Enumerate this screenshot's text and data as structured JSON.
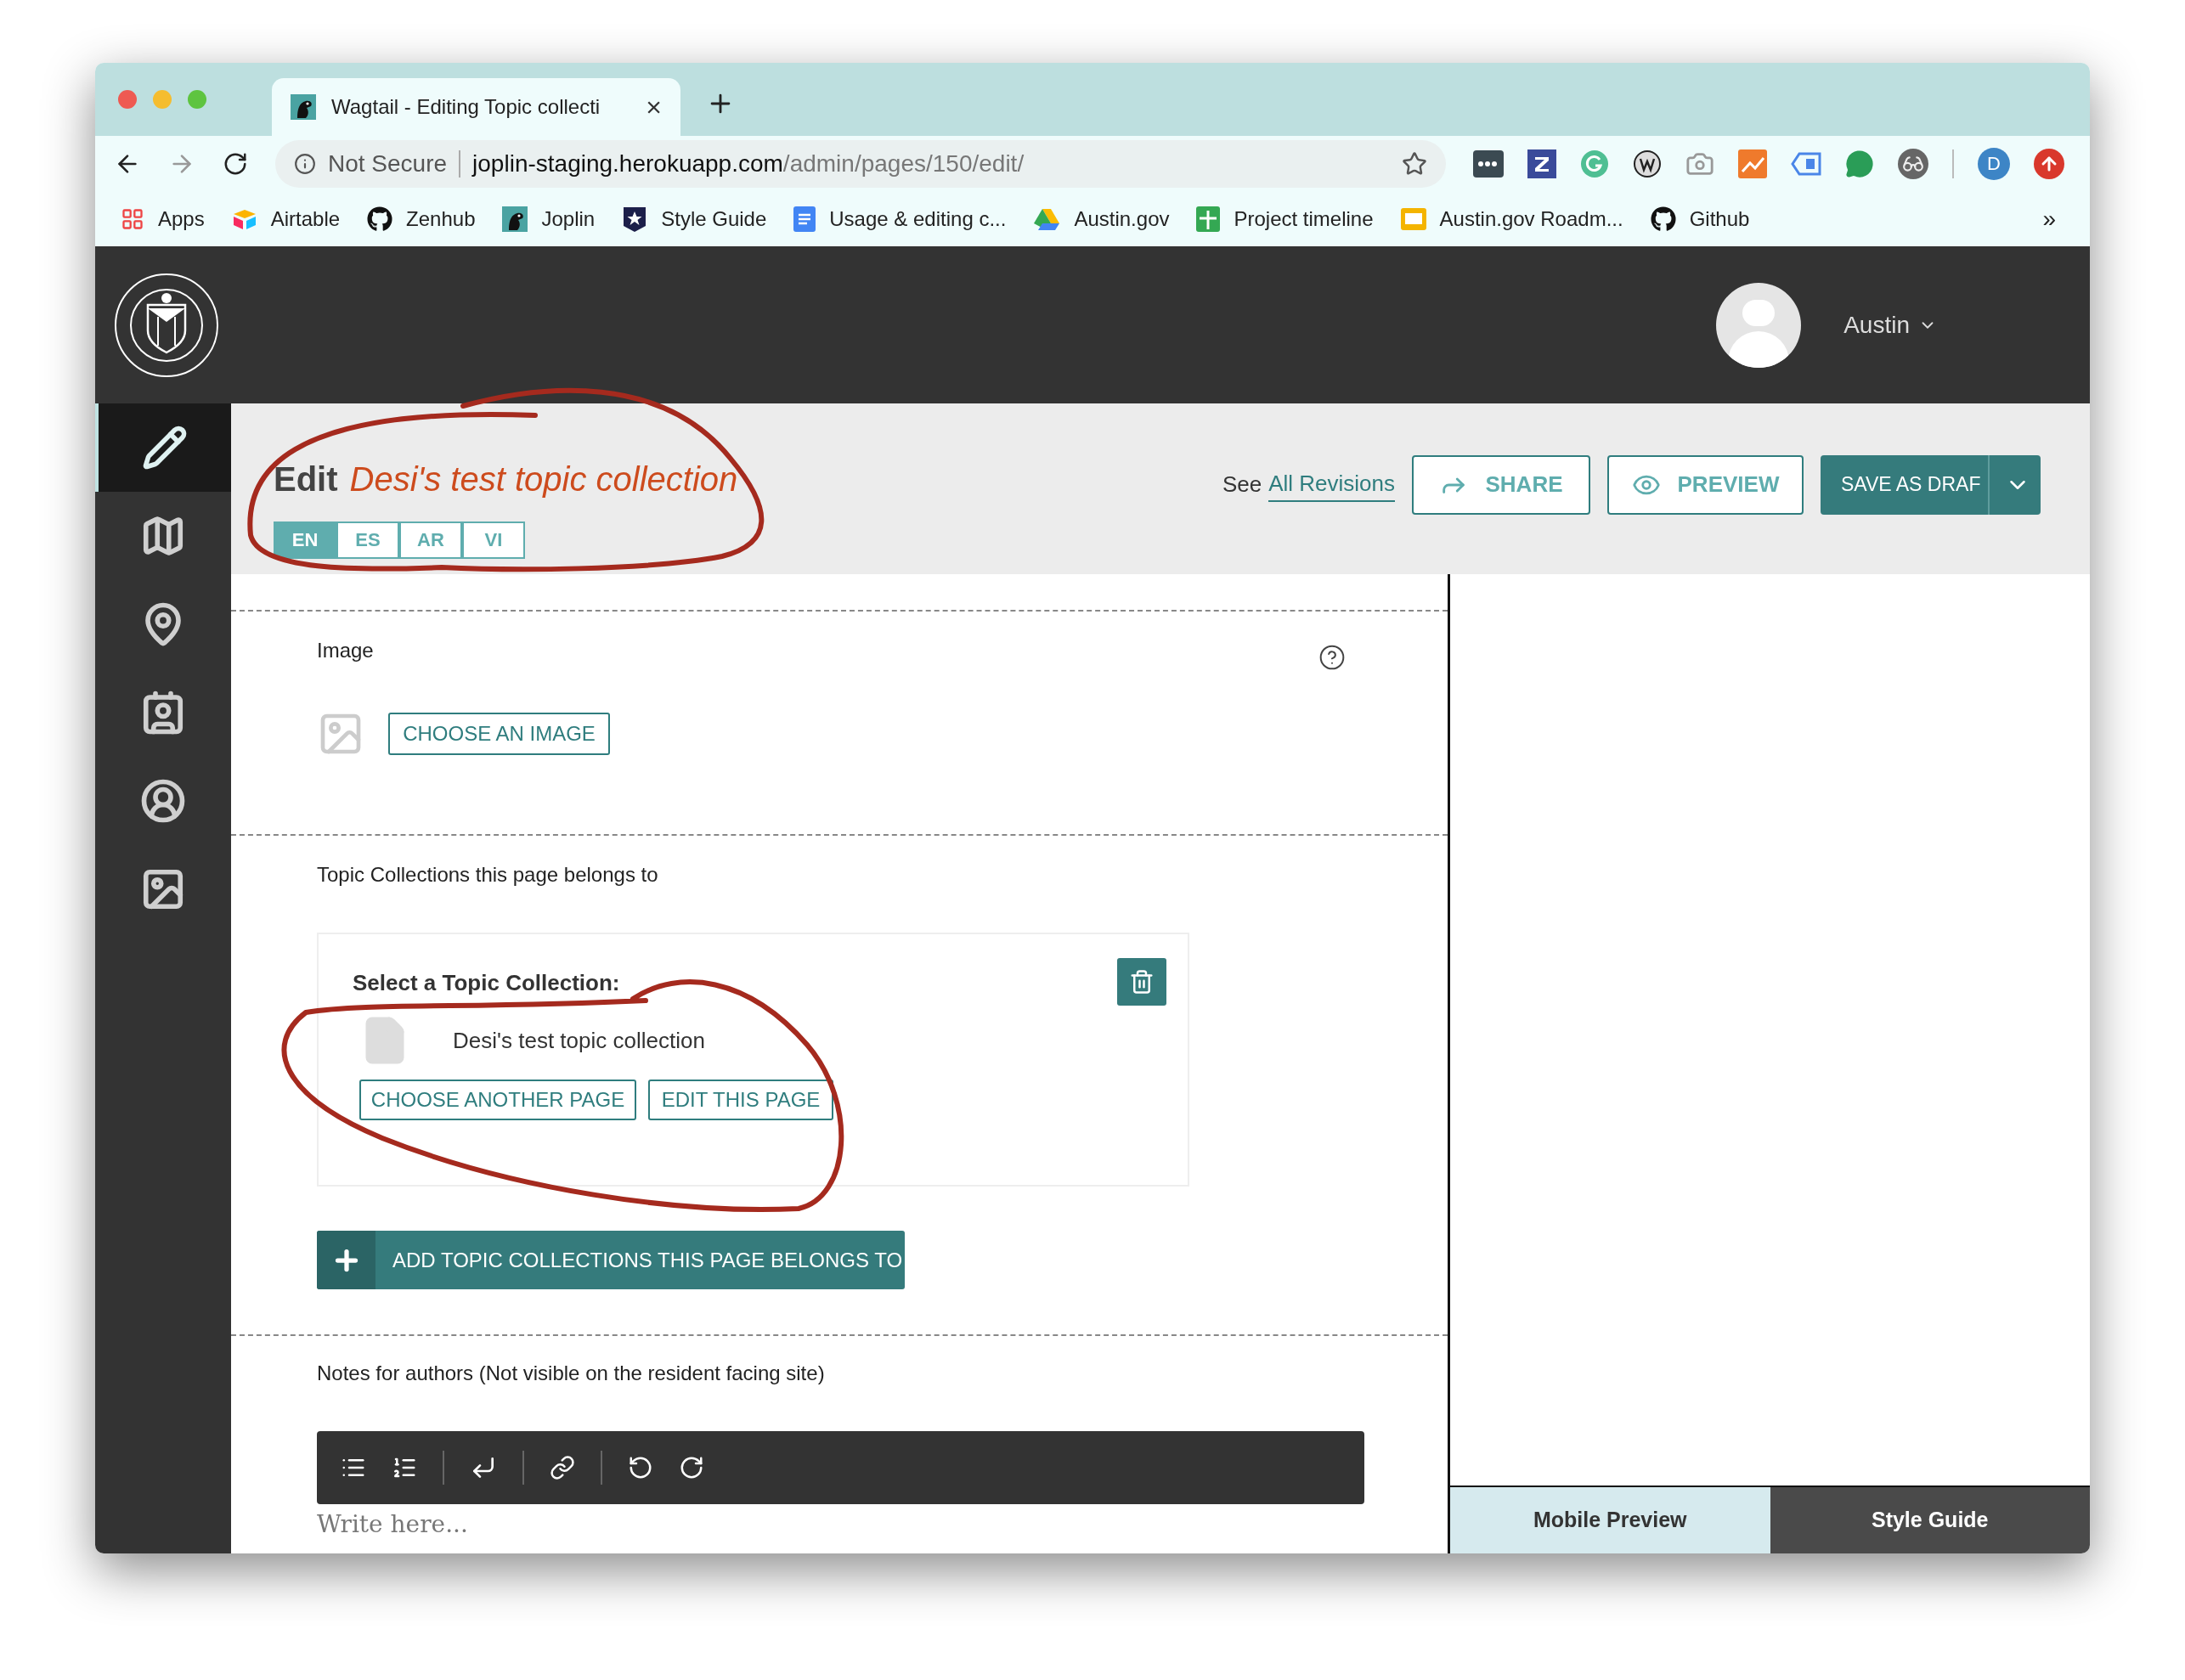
{
  "browser": {
    "tab": {
      "title": "Wagtail - Editing Topic collecti",
      "close": "×"
    },
    "address": {
      "security": "Not Secure",
      "host": "joplin-staging.herokuapp.com",
      "path": "/admin/pages/150/edit/"
    },
    "profile_initial": "D",
    "bookmarks": [
      {
        "label": "Apps"
      },
      {
        "label": "Airtable"
      },
      {
        "label": "Zenhub"
      },
      {
        "label": "Joplin"
      },
      {
        "label": "Style Guide"
      },
      {
        "label": "Usage & editing c..."
      },
      {
        "label": "Austin.gov"
      },
      {
        "label": "Project timeline"
      },
      {
        "label": "Austin.gov Roadm..."
      },
      {
        "label": "Github"
      }
    ],
    "bookmarks_more": "»"
  },
  "header": {
    "user": "Austin"
  },
  "sidebar": {
    "items": [
      {
        "selected": true
      },
      {
        "selected": false
      },
      {
        "selected": false
      },
      {
        "selected": false
      },
      {
        "selected": false
      },
      {
        "selected": false
      }
    ]
  },
  "page_header": {
    "action": "Edit",
    "title": "Desi's test topic collection",
    "locales": [
      {
        "label": "EN",
        "selected": true
      },
      {
        "label": "ES",
        "selected": false
      },
      {
        "label": "AR",
        "selected": false
      },
      {
        "label": "VI",
        "selected": false
      }
    ],
    "revisions_prefix": "See",
    "revisions_link": "All Revisions",
    "share": "SHARE",
    "preview": "PREVIEW",
    "save": "SAVE AS DRAF"
  },
  "form": {
    "image": {
      "label": "Image",
      "button": "CHOOSE AN IMAGE"
    },
    "topic_collections": {
      "label": "Topic Collections this page belongs to",
      "card_heading": "Select a Topic Collection:",
      "chosen_page": "Desi's test topic collection",
      "choose_another": "CHOOSE ANOTHER PAGE",
      "edit_page": "EDIT THIS PAGE",
      "add_button": "ADD TOPIC COLLECTIONS THIS PAGE BELONGS TO"
    },
    "notes": {
      "label": "Notes for authors (Not visible on the resident facing site)",
      "placeholder": "Write here..."
    }
  },
  "preview_tabs": [
    {
      "label": "Mobile Preview",
      "selected": true
    },
    {
      "label": "Style Guide",
      "selected": false
    }
  ]
}
